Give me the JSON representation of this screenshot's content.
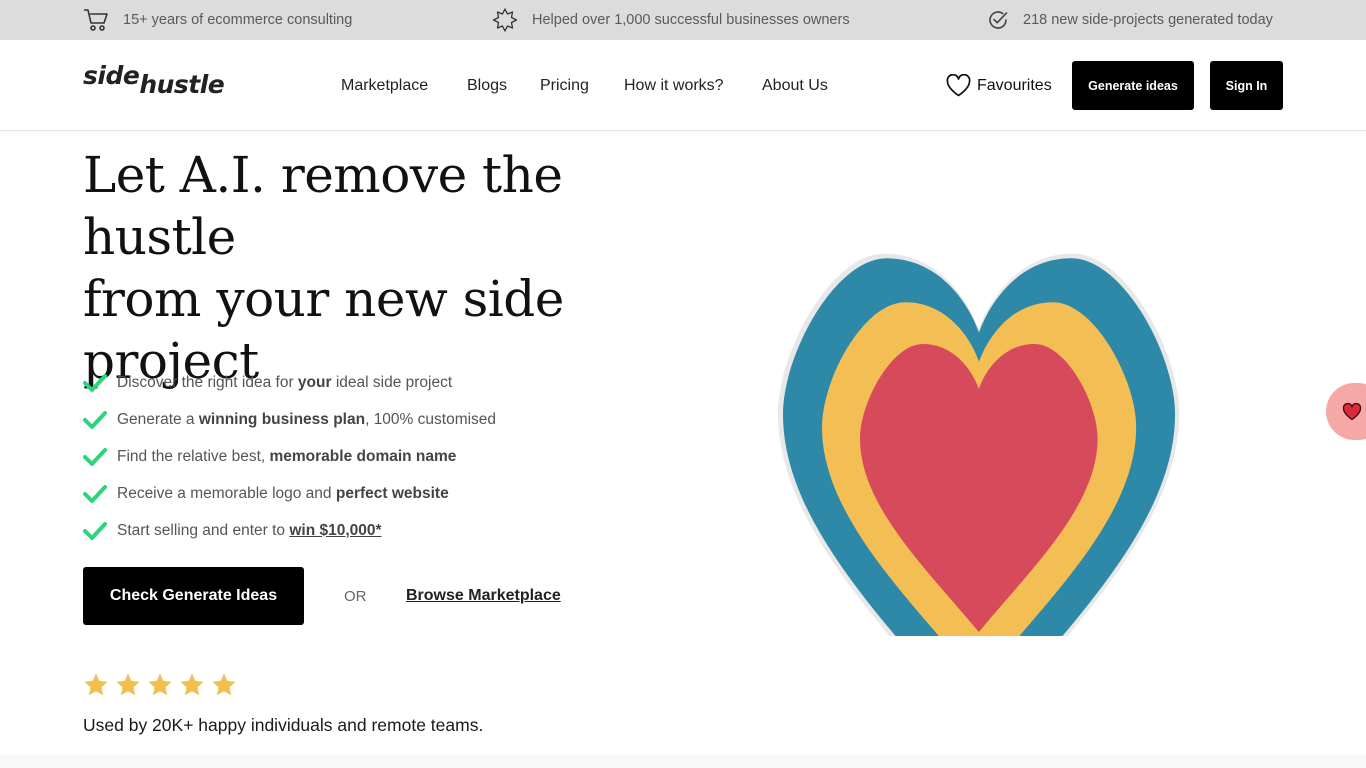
{
  "topbar": {
    "items": [
      {
        "icon": "cart-icon",
        "text": "15+ years of ecommerce consulting"
      },
      {
        "icon": "badge-icon",
        "text": "Helped over 1,000 successful businesses owners"
      },
      {
        "icon": "check-circle-icon",
        "text": "218 new side-projects generated today"
      }
    ]
  },
  "header": {
    "logo_part1": "side",
    "logo_part2": "hustle",
    "nav": [
      "Marketplace",
      "Blogs",
      "Pricing",
      "How it works?",
      "About Us"
    ],
    "favourites_label": "Favourites",
    "generate_label": "Generate ideas",
    "signin_label": "Sign In"
  },
  "hero": {
    "title_line1": "Let A.I. remove the hustle",
    "title_line2": "from your new side",
    "title_line3": "project",
    "features": [
      {
        "pre": "Discover the right idea for ",
        "bold": "your",
        "post": " ideal side project"
      },
      {
        "pre": "Generate a ",
        "bold": "winning business plan",
        "post": ", 100% customised"
      },
      {
        "pre": "Find the relative best, ",
        "bold": "memorable domain name",
        "post": ""
      },
      {
        "pre": "Receive a memorable logo and ",
        "bold": "perfect website",
        "post": ""
      },
      {
        "pre": "Start selling and enter to ",
        "link": "win $10,000*",
        "post": ""
      }
    ],
    "cta_label": "Check Generate Ideas",
    "or_label": "OR",
    "browse_label": "Browse Marketplace",
    "rating_stars": 5,
    "used_text": "Used by 20K+ happy individuals and remote teams."
  },
  "colors": {
    "accent_check": "#2ed47a",
    "star": "#f2c04e",
    "heart_outer": "#2e88a8",
    "heart_middle": "#f3bf55",
    "heart_inner": "#d64a5b",
    "float_button": "#f6a8a6"
  }
}
